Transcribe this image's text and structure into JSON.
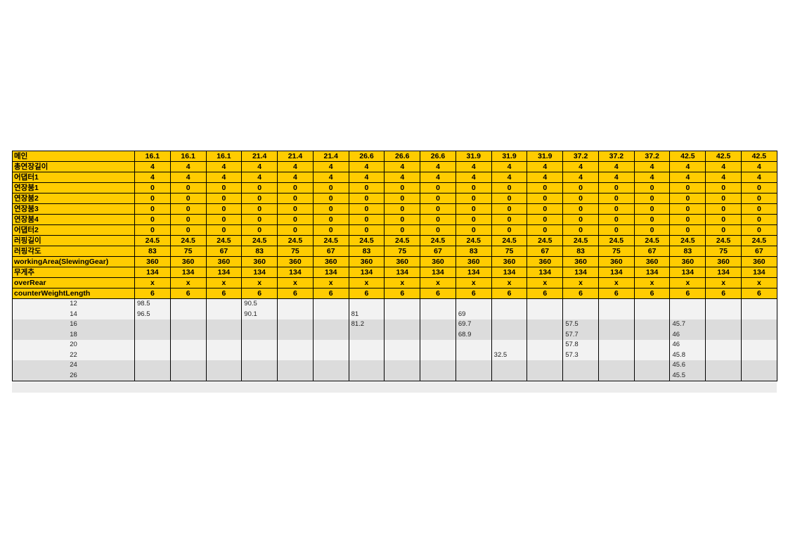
{
  "table": {
    "header_rows": [
      {
        "label": "메인",
        "values": [
          "16.1",
          "16.1",
          "16.1",
          "21.4",
          "21.4",
          "21.4",
          "26.6",
          "26.6",
          "26.6",
          "31.9",
          "31.9",
          "31.9",
          "37.2",
          "37.2",
          "37.2",
          "42.5",
          "42.5",
          "42.5"
        ]
      },
      {
        "label": "총연장길이",
        "values": [
          "4",
          "4",
          "4",
          "4",
          "4",
          "4",
          "4",
          "4",
          "4",
          "4",
          "4",
          "4",
          "4",
          "4",
          "4",
          "4",
          "4",
          "4"
        ]
      },
      {
        "label": "어댑터1",
        "values": [
          "4",
          "4",
          "4",
          "4",
          "4",
          "4",
          "4",
          "4",
          "4",
          "4",
          "4",
          "4",
          "4",
          "4",
          "4",
          "4",
          "4",
          "4"
        ]
      },
      {
        "label": "연장붐1",
        "values": [
          "0",
          "0",
          "0",
          "0",
          "0",
          "0",
          "0",
          "0",
          "0",
          "0",
          "0",
          "0",
          "0",
          "0",
          "0",
          "0",
          "0",
          "0"
        ]
      },
      {
        "label": "연장붐2",
        "values": [
          "0",
          "0",
          "0",
          "0",
          "0",
          "0",
          "0",
          "0",
          "0",
          "0",
          "0",
          "0",
          "0",
          "0",
          "0",
          "0",
          "0",
          "0"
        ]
      },
      {
        "label": "연장붐3",
        "values": [
          "0",
          "0",
          "0",
          "0",
          "0",
          "0",
          "0",
          "0",
          "0",
          "0",
          "0",
          "0",
          "0",
          "0",
          "0",
          "0",
          "0",
          "0"
        ]
      },
      {
        "label": "연장붐4",
        "values": [
          "0",
          "0",
          "0",
          "0",
          "0",
          "0",
          "0",
          "0",
          "0",
          "0",
          "0",
          "0",
          "0",
          "0",
          "0",
          "0",
          "0",
          "0"
        ]
      },
      {
        "label": "어댑터2",
        "values": [
          "0",
          "0",
          "0",
          "0",
          "0",
          "0",
          "0",
          "0",
          "0",
          "0",
          "0",
          "0",
          "0",
          "0",
          "0",
          "0",
          "0",
          "0"
        ]
      },
      {
        "label": "러핑길이",
        "values": [
          "24.5",
          "24.5",
          "24.5",
          "24.5",
          "24.5",
          "24.5",
          "24.5",
          "24.5",
          "24.5",
          "24.5",
          "24.5",
          "24.5",
          "24.5",
          "24.5",
          "24.5",
          "24.5",
          "24.5",
          "24.5"
        ]
      },
      {
        "label": "러핑각도",
        "values": [
          "83",
          "75",
          "67",
          "83",
          "75",
          "67",
          "83",
          "75",
          "67",
          "83",
          "75",
          "67",
          "83",
          "75",
          "67",
          "83",
          "75",
          "67"
        ]
      },
      {
        "label": "workingArea(SlewingGear)",
        "values": [
          "360",
          "360",
          "360",
          "360",
          "360",
          "360",
          "360",
          "360",
          "360",
          "360",
          "360",
          "360",
          "360",
          "360",
          "360",
          "360",
          "360",
          "360"
        ]
      },
      {
        "label": "무게추",
        "values": [
          "134",
          "134",
          "134",
          "134",
          "134",
          "134",
          "134",
          "134",
          "134",
          "134",
          "134",
          "134",
          "134",
          "134",
          "134",
          "134",
          "134",
          "134"
        ]
      },
      {
        "label": "overRear",
        "values": [
          "x",
          "x",
          "x",
          "x",
          "x",
          "x",
          "x",
          "x",
          "x",
          "x",
          "x",
          "x",
          "x",
          "x",
          "x",
          "x",
          "x",
          "x"
        ]
      },
      {
        "label": "counterWeightLength",
        "values": [
          "6",
          "6",
          "6",
          "6",
          "6",
          "6",
          "6",
          "6",
          "6",
          "6",
          "6",
          "6",
          "6",
          "6",
          "6",
          "6",
          "6",
          "6"
        ]
      }
    ],
    "data_rows": [
      {
        "radius": "12",
        "values": [
          "98.5",
          "",
          "",
          "90.5",
          "",
          "",
          "",
          "",
          "",
          "",
          "",
          "",
          "",
          "",
          "",
          "",
          "",
          ""
        ]
      },
      {
        "radius": "14",
        "values": [
          "96.5",
          "",
          "",
          "90.1",
          "",
          "",
          "81",
          "",
          "",
          "69",
          "",
          "",
          "",
          "",
          "",
          "",
          "",
          ""
        ]
      },
      {
        "radius": "16",
        "values": [
          "",
          "",
          "",
          "",
          "",
          "",
          "81.2",
          "",
          "",
          "69.7",
          "",
          "",
          "57.5",
          "",
          "",
          "45.7",
          "",
          ""
        ]
      },
      {
        "radius": "18",
        "values": [
          "",
          "",
          "",
          "",
          "",
          "",
          "",
          "",
          "",
          "68.9",
          "",
          "",
          "57.7",
          "",
          "",
          "46",
          "",
          ""
        ]
      },
      {
        "radius": "20",
        "values": [
          "",
          "",
          "",
          "",
          "",
          "",
          "",
          "",
          "",
          "",
          "",
          "",
          "57.8",
          "",
          "",
          "46",
          "",
          ""
        ]
      },
      {
        "radius": "22",
        "values": [
          "",
          "",
          "",
          "",
          "",
          "",
          "",
          "",
          "",
          "",
          "32.5",
          "",
          "57.3",
          "",
          "",
          "45.8",
          "",
          ""
        ]
      },
      {
        "radius": "24",
        "values": [
          "",
          "",
          "",
          "",
          "",
          "",
          "",
          "",
          "",
          "",
          "",
          "",
          "",
          "",
          "",
          "45.6",
          "",
          ""
        ]
      },
      {
        "radius": "26",
        "values": [
          "",
          "",
          "",
          "",
          "",
          "",
          "",
          "",
          "",
          "",
          "",
          "",
          "",
          "",
          "",
          "45.5",
          "",
          ""
        ]
      }
    ]
  }
}
